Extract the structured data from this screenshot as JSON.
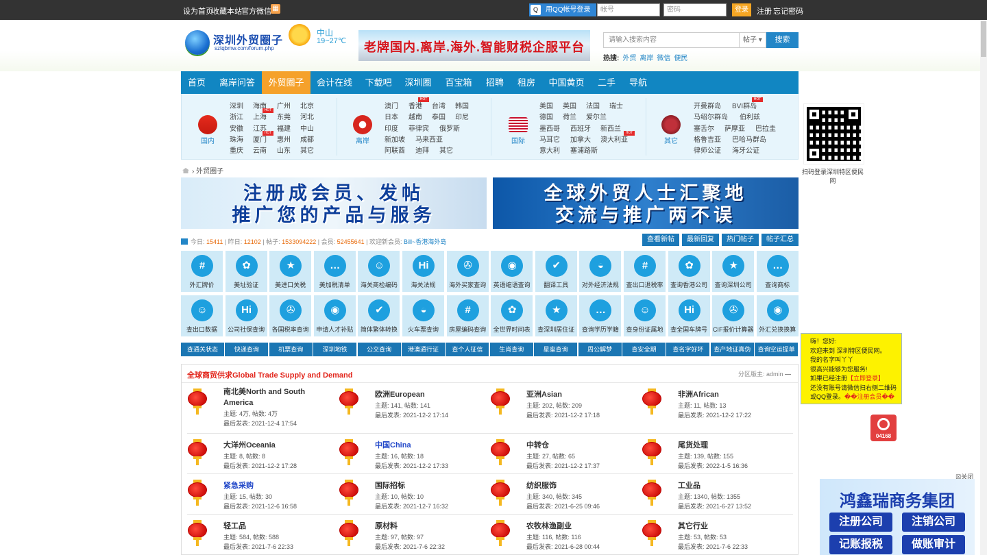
{
  "topbar": {
    "links": [
      "设为首页",
      "收藏本站",
      "官方微信"
    ],
    "qq_login": "用QQ帐号登录",
    "username_placeholder": "帐号",
    "password_placeholder": "密码",
    "login": "登录",
    "register": "注册",
    "forgot": "忘记密码"
  },
  "header": {
    "logo_title": "深圳外贸圈子",
    "logo_url": "sztqbmw.com/forum.php",
    "city": "中山",
    "temp": "19~27℃",
    "banner": "老牌国内.离岸.海外.智能财税企服平台",
    "search_placeholder": "请输入搜索内容",
    "search_type": "帖子",
    "search_button": "搜索",
    "hot_label": "热搜:",
    "hot": [
      "外贸",
      "离岸",
      "微信",
      "便民"
    ]
  },
  "nav": [
    "首页",
    "离岸问答",
    "外贸圈子",
    "会计在线",
    "下载吧",
    "深圳圈",
    "百宝箱",
    "招聘",
    "租房",
    "中国黄页",
    "二手",
    "导航"
  ],
  "regions": [
    {
      "name": "国内",
      "cities": [
        [
          "深圳",
          "海南",
          "广州",
          "北京"
        ],
        [
          "浙江",
          "上海",
          "东莞",
          "河北"
        ],
        [
          "安徽",
          "江苏",
          "福建",
          "中山"
        ],
        [
          "珠海",
          "厦门",
          "惠州",
          "成都"
        ],
        [
          "重庆",
          "云南",
          "山东",
          "其它"
        ]
      ]
    },
    {
      "name": "离岸",
      "cities": [
        [
          "澳门",
          "香港",
          "台湾",
          "韩国"
        ],
        [
          "日本",
          "越南",
          "泰国",
          "印尼"
        ],
        [
          "印度",
          "菲律宾",
          "俄罗斯"
        ],
        [
          "新加坡",
          "马来西亚"
        ],
        [
          "阿联酋",
          "迪拜",
          "其它"
        ]
      ]
    },
    {
      "name": "国际",
      "cities": [
        [
          "美国",
          "英国",
          "法国",
          "瑞士"
        ],
        [
          "德国",
          "荷兰",
          "爱尔兰"
        ],
        [
          "墨西哥",
          "西班牙",
          "新西兰"
        ],
        [
          "马耳它",
          "加拿大",
          "澳大利亚"
        ],
        [
          "意大利",
          "塞浦路斯"
        ]
      ]
    },
    {
      "name": "其它",
      "cities": [
        [
          "开曼群岛",
          "BVI群岛"
        ],
        [
          "马绍尔群岛",
          "伯利兹"
        ],
        [
          "塞舌尔",
          "萨摩亚",
          "巴拉圭"
        ],
        [
          "格鲁吉亚",
          "巴哈马群岛"
        ],
        [
          "律师公证",
          "海牙公证"
        ]
      ]
    }
  ],
  "hot_badge": "HOT",
  "qr_text": "扫码登录深圳特区便民网",
  "breadcrumb": "外贸圈子",
  "banners": [
    {
      "line1": "注册成会员、发帖",
      "line2": "推广您的产品与服务"
    },
    {
      "line1": "全球外贸人士汇聚地",
      "line2": "交流与推广两不误"
    }
  ],
  "stats": {
    "today_label": "今日:",
    "today": "15411",
    "yesterday_label": "昨日:",
    "yesterday": "12102",
    "posts_label": "帖子:",
    "posts": "1533094222",
    "members_label": "会员:",
    "members": "52455641",
    "new_member_label": "欢迎新会员:",
    "new_member": "Bill~香港海外岛"
  },
  "stat_buttons": [
    "查看新帖",
    "最新回复",
    "热门帖子",
    "帖子汇总"
  ],
  "tools_row1": [
    {
      "label": "外汇牌价",
      "glyph": "#"
    },
    {
      "label": "美址验证",
      "glyph": "✿"
    },
    {
      "label": "美进口关税",
      "glyph": "★"
    },
    {
      "label": "美加税清单",
      "glyph": "…"
    },
    {
      "label": "海关商检编码",
      "glyph": "☺"
    },
    {
      "label": "海关法规",
      "glyph": "Hi"
    },
    {
      "label": "海外买家查询",
      "glyph": "✇"
    },
    {
      "label": "英语缩语查询",
      "glyph": "◉"
    },
    {
      "label": "翻译工具",
      "glyph": "✔"
    },
    {
      "label": "对外经济法规",
      "glyph": "◒"
    },
    {
      "label": "查出口退税率",
      "glyph": "#"
    },
    {
      "label": "查询香港公司",
      "glyph": "✿"
    },
    {
      "label": "查询深圳公司",
      "glyph": "★"
    },
    {
      "label": "查询商标",
      "glyph": "…"
    }
  ],
  "tools_row2": [
    {
      "label": "查出口数据",
      "glyph": "☺"
    },
    {
      "label": "公司社保查询",
      "glyph": "Hi"
    },
    {
      "label": "各国税率查询",
      "glyph": "✇"
    },
    {
      "label": "申请人才补贴",
      "glyph": "◉"
    },
    {
      "label": "简体繁体转换",
      "glyph": "✔"
    },
    {
      "label": "火车票查询",
      "glyph": "◒"
    },
    {
      "label": "房屋编码查询",
      "glyph": "#"
    },
    {
      "label": "全世界时间表",
      "glyph": "✿"
    },
    {
      "label": "查深圳居住证",
      "glyph": "★"
    },
    {
      "label": "查询学历学籍",
      "glyph": "…"
    },
    {
      "label": "查身份证属地",
      "glyph": "☺"
    },
    {
      "label": "查全国车牌号",
      "glyph": "Hi"
    },
    {
      "label": "CIF报价计算器",
      "glyph": "✇"
    },
    {
      "label": "外汇兑换换算",
      "glyph": "◉"
    }
  ],
  "queries": [
    "查通关状态",
    "快递查询",
    "机票查询",
    "深圳地铁",
    "公交查询",
    "港澳通行证",
    "查个人征信",
    "生肖查询",
    "星座查询",
    "周公解梦",
    "查安全期",
    "查名字好坏",
    "查产地证真伪",
    "查询空运提单"
  ],
  "forum": {
    "title": "全球商贸供求Global Trade Supply and Demand",
    "moderator": "分区版主: admin",
    "boards": [
      {
        "name": "南北美North and South America",
        "stats": "主题: 4万, 帖数: 4万",
        "last": "最后发表: 2021-12-4 17:54",
        "blue": false
      },
      {
        "name": "欧洲European",
        "stats": "主题: 141, 帖数: 141",
        "last": "最后发表: 2021-12-2 17:14",
        "blue": false
      },
      {
        "name": "亚洲Asian",
        "stats": "主题: 202, 帖数: 209",
        "last": "最后发表: 2021-12-2 17:18",
        "blue": false
      },
      {
        "name": "非洲African",
        "stats": "主题: 11, 帖数: 13",
        "last": "最后发表: 2021-12-2 17:22",
        "blue": false
      },
      {
        "name": "大洋州Oceania",
        "stats": "主题: 8, 帖数: 8",
        "last": "最后发表: 2021-12-2 17:28",
        "blue": false
      },
      {
        "name": "中国China",
        "stats": "主题: 16, 帖数: 18",
        "last": "最后发表: 2021-12-2 17:33",
        "blue": true
      },
      {
        "name": "中转仓",
        "stats": "主题: 27, 帖数: 65",
        "last": "最后发表: 2021-12-2 17:37",
        "blue": false
      },
      {
        "name": "尾货处理",
        "stats": "主题: 139, 帖数: 155",
        "last": "最后发表: 2022-1-5 16:36",
        "blue": false
      },
      {
        "name": "紧急采购",
        "stats": "主题: 15, 帖数: 30",
        "last": "最后发表: 2021-12-6 16:58",
        "blue": true
      },
      {
        "name": "国际招标",
        "stats": "主题: 10, 帖数: 10",
        "last": "最后发表: 2021-12-7 16:32",
        "blue": false
      },
      {
        "name": "纺织服饰",
        "stats": "主题: 340, 帖数: 345",
        "last": "最后发表: 2021-6-25 09:46",
        "blue": false
      },
      {
        "name": "工业品",
        "stats": "主题: 1340, 帖数: 1355",
        "last": "最后发表: 2021-6-27 13:52",
        "blue": false
      },
      {
        "name": "轻工品",
        "stats": "主题: 584, 帖数: 588",
        "last": "最后发表: 2021-7-6 22:33",
        "blue": false
      },
      {
        "name": "原材料",
        "stats": "主题: 97, 帖数: 97",
        "last": "最后发表: 2021-7-6 22:32",
        "blue": false
      },
      {
        "name": "农牧林渔副业",
        "stats": "主题: 116, 帖数: 116",
        "last": "最后发表: 2021-6-28 00:44",
        "blue": false
      },
      {
        "name": "其它行业",
        "stats": "主题: 53, 帖数: 53",
        "last": "最后发表: 2021-7-6 22:33",
        "blue": false
      }
    ]
  },
  "bubble": {
    "lines": [
      "嗨！您好:",
      "欢迎来到 深圳特区便民网。",
      "我的名字叫丫丫",
      "很高兴能够为您服务!"
    ],
    "line5_a": "如果已经注册",
    "line5_b": "【立即登录】",
    "line6": "还没有账号请微信扫右侧二维码",
    "line7_a": "或QQ登录。",
    "line7_b": "��注册会员��"
  },
  "cnzz": "04168",
  "ad": {
    "close": "关闭",
    "title": "鸿鑫瑞商务集团",
    "items": [
      "注册公司",
      "注销公司",
      "记账报税",
      "做账审计"
    ]
  }
}
